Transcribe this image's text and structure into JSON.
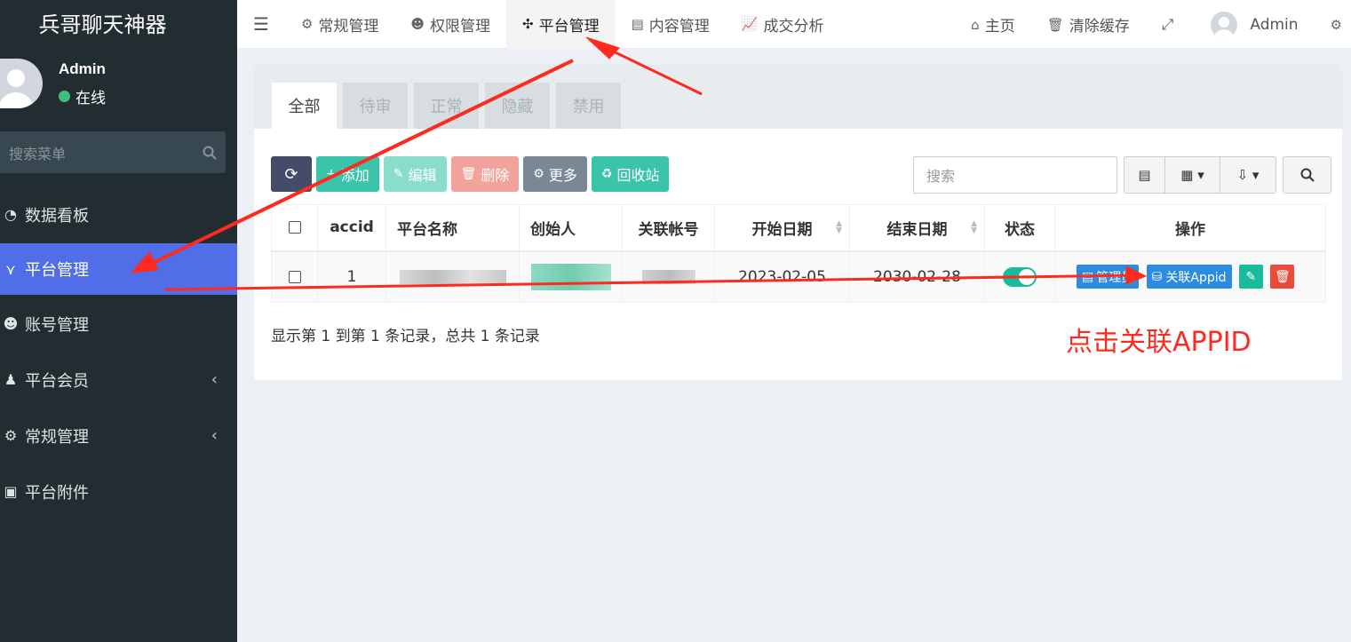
{
  "sidebar": {
    "logo": "兵哥聊天神器",
    "user": {
      "name": "Admin",
      "status": "在线"
    },
    "search_placeholder": "搜索菜单",
    "items": [
      {
        "label": "数据看板",
        "icon": "dashboard-icon"
      },
      {
        "label": "平台管理",
        "icon": "platform-icon",
        "active": true
      },
      {
        "label": "账号管理",
        "icon": "users-icon"
      },
      {
        "label": "平台会员",
        "icon": "user-icon",
        "caret": "‹"
      },
      {
        "label": "常规管理",
        "icon": "cogs-icon",
        "caret": "‹"
      },
      {
        "label": "平台附件",
        "icon": "image-icon"
      }
    ]
  },
  "navbar": {
    "menu_icon": "hamburger-icon",
    "tabs": [
      {
        "label": "常规管理",
        "icon": "cogs-icon"
      },
      {
        "label": "权限管理",
        "icon": "users-icon"
      },
      {
        "label": "平台管理",
        "icon": "platform-icon",
        "active": true
      },
      {
        "label": "内容管理",
        "icon": "newspaper-icon"
      },
      {
        "label": "成交分析",
        "icon": "line-chart-icon"
      }
    ],
    "right": {
      "home": "主页",
      "clear_cache": "清除缓存",
      "user": "Admin"
    }
  },
  "content": {
    "tabs": [
      "全部",
      "待审",
      "正常",
      "隐藏",
      "禁用"
    ],
    "toolbar": {
      "add": "添加",
      "edit": "编辑",
      "delete": "删除",
      "more": "更多",
      "recycle": "回收站"
    },
    "search_placeholder": "搜索",
    "table": {
      "columns": [
        "accid",
        "平台名称",
        "创始人",
        "关联帐号",
        "开始日期",
        "结束日期",
        "状态",
        "操作"
      ],
      "rows": [
        {
          "accid": "1",
          "start_date": "2023-02-05",
          "end_date": "2030-02-28",
          "ops": {
            "manage": "管理员",
            "link_appid": "关联Appid"
          }
        }
      ]
    },
    "records": "显示第 1 到第 1 条记录，总共 1 条记录"
  },
  "annotation": "点击关联APPID",
  "colors": {
    "sidebar_bg": "#222d32",
    "active_menu": "#4f6ee8",
    "primary": "#18bc9c",
    "danger": "#e74c3c",
    "annotation": "#ff2a1f"
  }
}
